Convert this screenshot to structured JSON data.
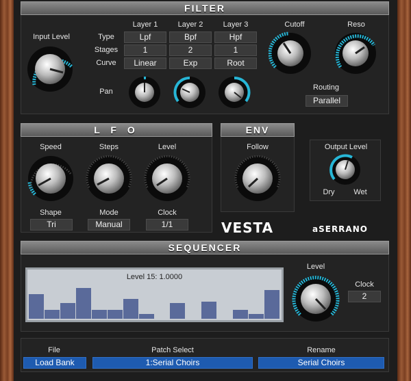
{
  "filter": {
    "title": "FILTER",
    "input_level_label": "Input Level",
    "row_labels": {
      "type": "Type",
      "stages": "Stages",
      "curve": "Curve",
      "pan": "Pan"
    },
    "layers": [
      {
        "name": "Layer 1",
        "type": "Lpf",
        "stages": "1",
        "curve": "Linear"
      },
      {
        "name": "Layer 2",
        "type": "Bpf",
        "stages": "2",
        "curve": "Exp"
      },
      {
        "name": "Layer 3",
        "type": "Hpf",
        "stages": "1",
        "curve": "Root"
      }
    ],
    "cutoff_label": "Cutoff",
    "reso_label": "Reso",
    "routing_label": "Routing",
    "routing_value": "Parallel"
  },
  "lfo": {
    "title": "L F O",
    "speed_label": "Speed",
    "steps_label": "Steps",
    "level_label": "Level",
    "shape_label": "Shape",
    "shape_value": "Tri",
    "mode_label": "Mode",
    "mode_value": "Manual",
    "clock_label": "Clock",
    "clock_value": "1/1"
  },
  "env": {
    "title": "ENV",
    "follow_label": "Follow"
  },
  "output": {
    "label": "Output Level",
    "dry": "Dry",
    "wet": "Wet"
  },
  "brand": {
    "product": "VESTA",
    "maker": "aSERRANO"
  },
  "sequencer": {
    "title": "SEQUENCER",
    "display": "Level 15: 1.0000",
    "level_label": "Level",
    "clock_label": "Clock",
    "clock_value": "2",
    "steps": [
      0.6,
      0.22,
      0.38,
      0.75,
      0.22,
      0.22,
      0.48,
      0.12,
      0.0,
      0.38,
      0.0,
      0.42,
      0.0,
      0.22,
      0.12,
      0.7
    ]
  },
  "footer": {
    "file_label": "File",
    "file_value": "Load Bank",
    "patch_label": "Patch Select",
    "patch_value": "1:Serial Choirs",
    "rename_label": "Rename",
    "rename_value": "Serial Choirs"
  },
  "colors": {
    "accent": "#27b6d6",
    "field_blue": "#1e5bb0",
    "seq_bar": "#5a6a9a"
  }
}
